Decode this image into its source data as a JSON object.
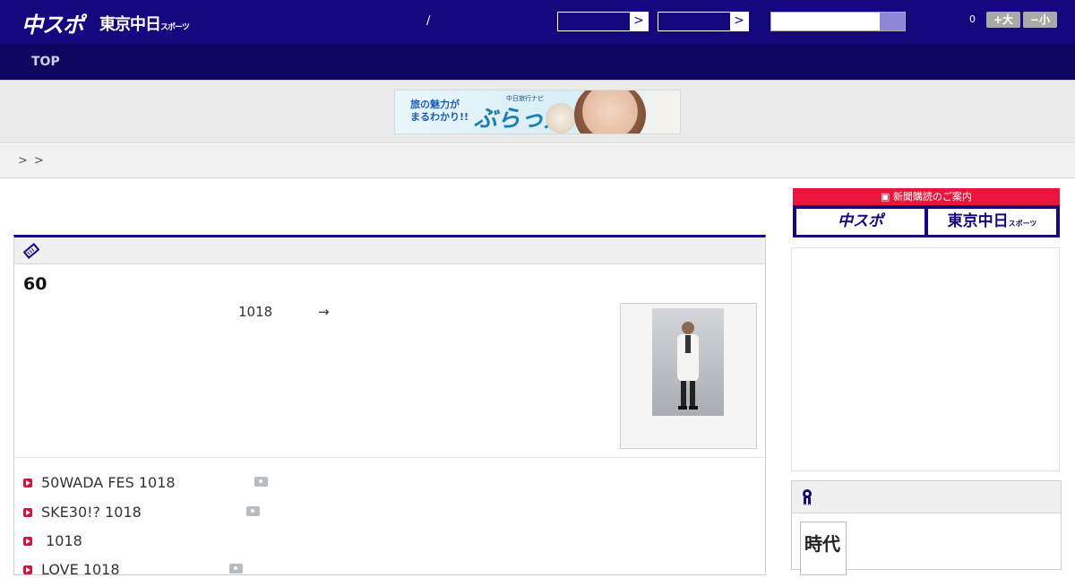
{
  "header": {
    "logo_main": "中スポ",
    "logo_sub": "東京中日",
    "logo_sub_small": "スポーツ",
    "slash": "/",
    "select1_arrow": ">",
    "select2_arrow": ">",
    "search_placeholder": "",
    "counter": "0",
    "font_larger": "+大",
    "font_smaller": "−小"
  },
  "nav": {
    "top_label": "TOP"
  },
  "banner": {
    "line1": "旅の魅力が",
    "line2": "まるわかり!!",
    "brand_small": "中日旅行ナビ",
    "brand": "ぶらっ人"
  },
  "breadcrumb": {
    "sep1": ">",
    "sep2": ">"
  },
  "article": {
    "title": "60",
    "lead_date": "1018",
    "lead_arrow": "→",
    "related": [
      {
        "label": "50WADA FES 1018",
        "has_photo": true
      },
      {
        "label": "SKE30!? 1018",
        "has_photo": true
      },
      {
        "label": " 1018",
        "has_photo": false
      },
      {
        "label": "LOVE 1018",
        "has_photo": true
      }
    ]
  },
  "sidebar": {
    "subscription_title": "新聞購読のご案内",
    "btn_chuspo": "中スポ",
    "btn_tokyo": "東京中日",
    "btn_tokyo_small": "スポーツ",
    "ranking_thumb": "時代"
  },
  "colors": {
    "header_bg": "#15077d",
    "nav_bg": "#0d0760",
    "accent_red": "#e8153d"
  }
}
